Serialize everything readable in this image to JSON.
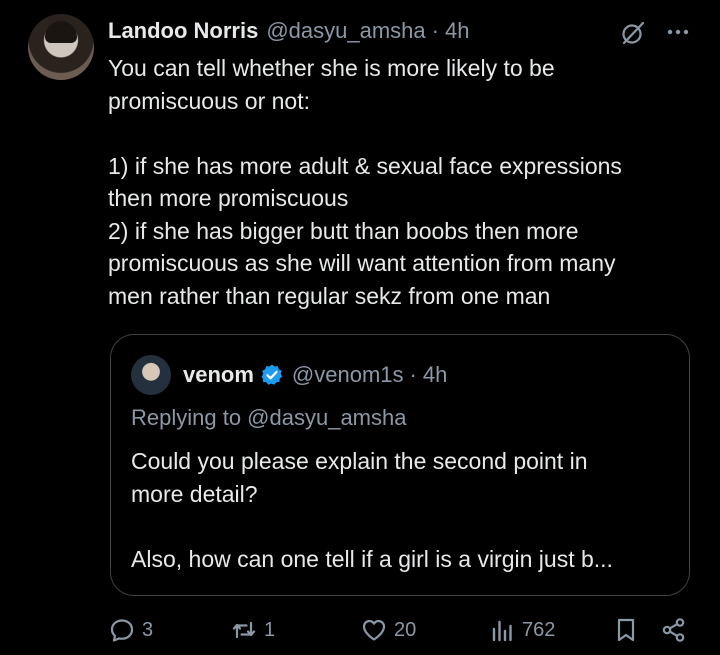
{
  "tweet": {
    "author_name": "Landoo Norris",
    "handle": "@dasyu_amsha",
    "separator": "·",
    "time": "4h",
    "lines": [
      "You can tell whether she is more likely to be",
      "promiscuous or not:",
      "",
      "1) if she has more adult &  sexual face expressions",
      "then more promiscuous",
      "2) if she has bigger butt than boobs then more",
      "promiscuous as she will want attention from many",
      "men rather than regular sekz from one man"
    ]
  },
  "quote": {
    "author_name": "venom",
    "verified": true,
    "handle": "@venom1s",
    "separator": "·",
    "time": "4h",
    "replying_to": "Replying to @dasyu_amsha",
    "lines": [
      "Could you please explain the second point in",
      "more detail?",
      "",
      "Also, how can one tell if a girl is a virgin just b..."
    ]
  },
  "actions": {
    "replies": "3",
    "reposts": "1",
    "likes": "20",
    "views": "762"
  },
  "icons": {
    "grok": "grok-icon",
    "more": "more-icon",
    "verified": "verified-icon",
    "reply": "reply-icon",
    "repost": "repost-icon",
    "like": "heart-icon",
    "views": "views-icon",
    "bookmark": "bookmark-icon",
    "share": "share-icon"
  },
  "colors": {
    "background": "#000000",
    "text": "#e7e9ea",
    "secondary": "#8b98a5",
    "verified": "#1d9bf0",
    "border": "#3e4144"
  }
}
